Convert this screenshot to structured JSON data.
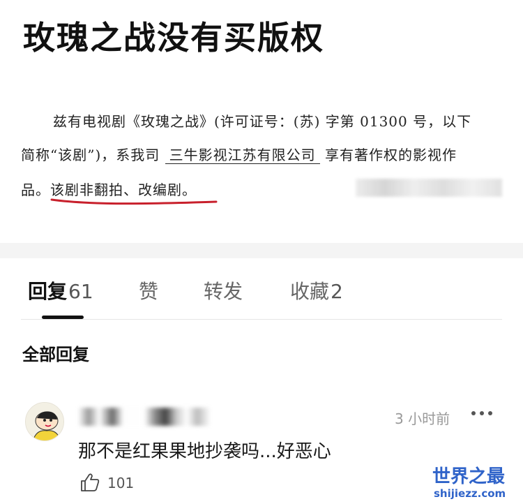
{
  "post": {
    "title": "玫瑰之战没有买版权"
  },
  "document": {
    "line1": "兹有电视剧《玫瑰之战》(许可证号：(苏) 字第 01300 号，以下",
    "line2_prefix": "简称“该剧”)，系我司",
    "line2_company": "三牛影视江苏有限公司",
    "line2_suffix": "享有著作权的影视作",
    "line3": "品。该剧非翻拍、改编剧。"
  },
  "tabs": {
    "reply_label": "回复",
    "reply_count": "61",
    "like_label": "赞",
    "share_label": "转发",
    "fav_label": "收藏",
    "fav_count": "2"
  },
  "replies": {
    "heading": "全部回复"
  },
  "comment": {
    "timestamp": "3 小时前",
    "text": "那不是红果果地抄袭吗...好恶心",
    "like_count": "101"
  },
  "watermark": {
    "main": "世界之最",
    "sub": "shijiezz.com"
  },
  "colors": {
    "underline_red": "#c8202c",
    "watermark_blue": "#2f63c9",
    "divider_gray": "#f4f4f4"
  }
}
